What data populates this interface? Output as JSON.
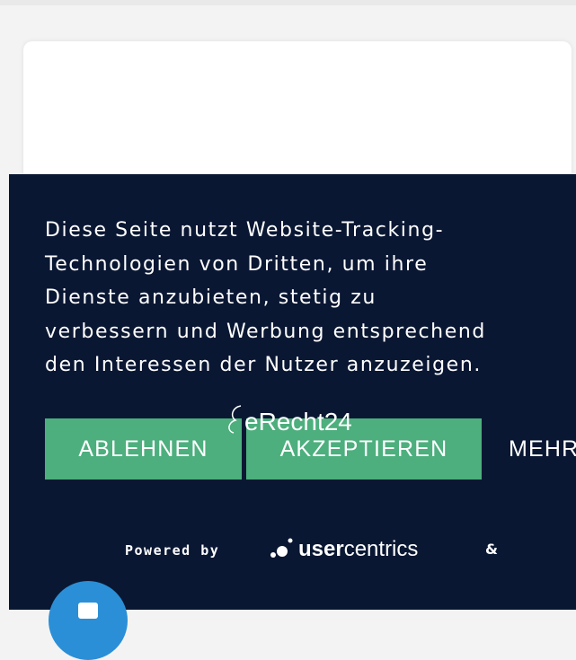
{
  "banner": {
    "message": "Diese Seite nutzt Website-Tracking-\nTechnologien von Dritten, um ihre\nDienste anzubieten, stetig zu\nverbessern und Werbung entsprechend\nden Interessen der Nutzer anzuzeigen.",
    "buttons": {
      "reject": "ABLEHNEN",
      "accept": "AKZEPTIEREN",
      "more": "MEHR"
    },
    "powered_by": "Powered by",
    "usercentrics": {
      "bold": "user",
      "regular": "centrics"
    },
    "ampersand": "&",
    "erecht": "eRecht24"
  },
  "colors": {
    "banner_bg": "#0a1733",
    "accent_green": "#4caf7d",
    "chat_blue": "#2a8fd6"
  },
  "icons": [
    "usercentrics-logo-icon",
    "erecht24-logo-icon",
    "chat-icon"
  ]
}
